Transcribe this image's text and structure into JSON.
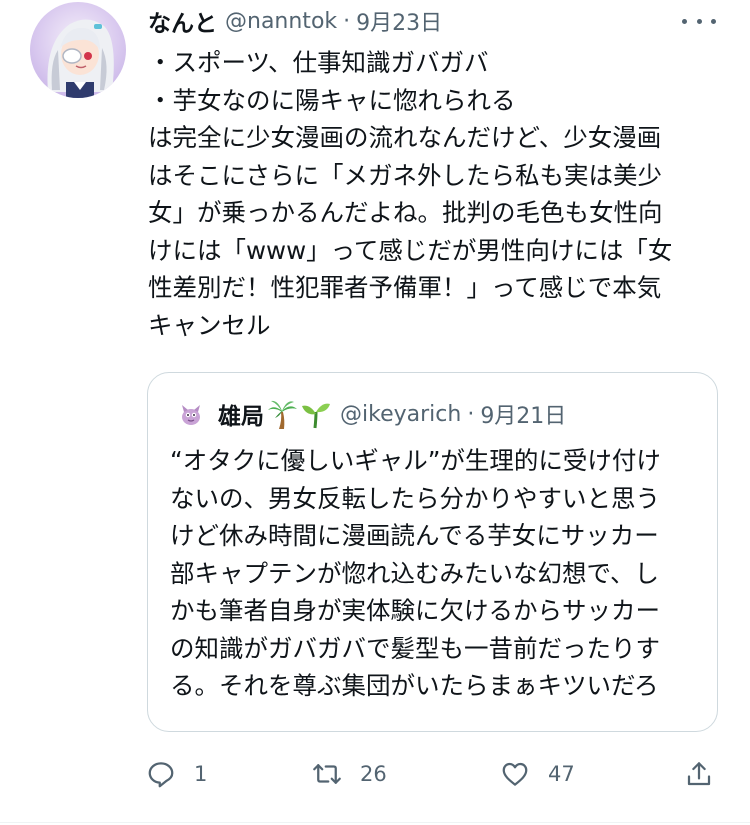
{
  "tweet": {
    "display_name": "なんと",
    "handle": "@nanntok",
    "separator": "·",
    "date": "9月23日",
    "text_lines": [
      "・スポーツ、仕事知識ガバガバ",
      "・芋女なのに陽キャに惚れられる",
      "は完全に少女漫画の流れなんだけど、少女漫画",
      "はそこにさらに「メガネ外したら私も実は美少",
      "女」が乗っかるんだよね。批判の毛色も女性向",
      "けには「www」って感じだが男性向けには「女",
      "性差別だ！性犯罪者予備軍！」って感じで本気",
      "キャンセル"
    ]
  },
  "quoted": {
    "display_name": "雄局",
    "emoji_icons": [
      "palm-tree-icon",
      "seedling-icon"
    ],
    "handle": "@ikeyarich",
    "separator": "·",
    "date": "9月21日",
    "text_lines": [
      "“オタクに優しいギャル”が生理的に受け付け",
      "ないの、男女反転したら分かりやすいと思う",
      "けど休み時間に漫画読んでる芋女にサッカー",
      "部キャプテンが惚れ込むみたいな幻想で、し",
      "かも筆者自身が実体験に欠けるからサッカー",
      "の知識がガバガバで髪型も一昔前だったりす",
      "る。それを尊ぶ集団がいたらまぁキツいだろ"
    ]
  },
  "actions": {
    "reply_count": "1",
    "retweet_count": "26",
    "like_count": "47",
    "icons": [
      "reply-icon",
      "retweet-icon",
      "like-icon",
      "share-icon"
    ]
  },
  "colors": {
    "text": "#0f1419",
    "secondary": "#536471",
    "border": "#cfd9de",
    "divider": "#eff3f4",
    "avatar_bg": "#d9c9ef"
  }
}
